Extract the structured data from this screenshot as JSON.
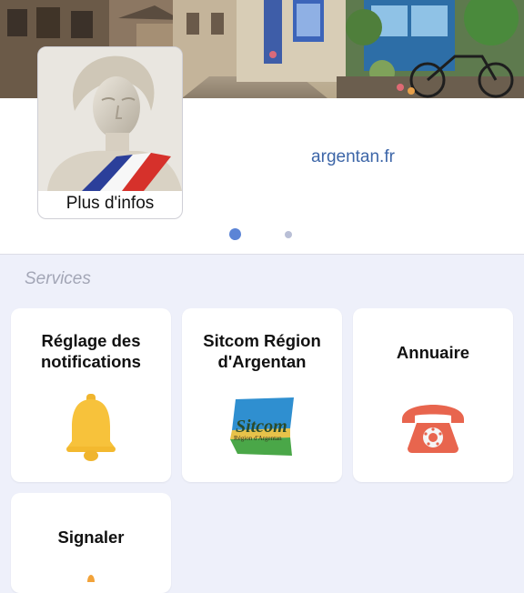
{
  "header": {
    "more_info_label": "Plus d'infos",
    "website_link": "argentan.fr"
  },
  "carousel": {
    "count": 2,
    "active_index": 0
  },
  "services": {
    "section_title": "Services",
    "tiles": [
      {
        "title": "Réglage des notifications",
        "icon": "bell-icon"
      },
      {
        "title": "Sitcom Région d'Argentan",
        "icon": "sitcom-logo",
        "logo_text": "Sitcom",
        "logo_subtext": "Région d'Argentan"
      },
      {
        "title": "Annuaire",
        "icon": "telephone-icon"
      },
      {
        "title": "Signaler",
        "icon": "alert-icon"
      }
    ]
  },
  "colors": {
    "accent": "#5b84d6",
    "link": "#3d66a8",
    "bell": "#f7c23b",
    "phone": "#e8654e",
    "background": "#eef0fa"
  }
}
